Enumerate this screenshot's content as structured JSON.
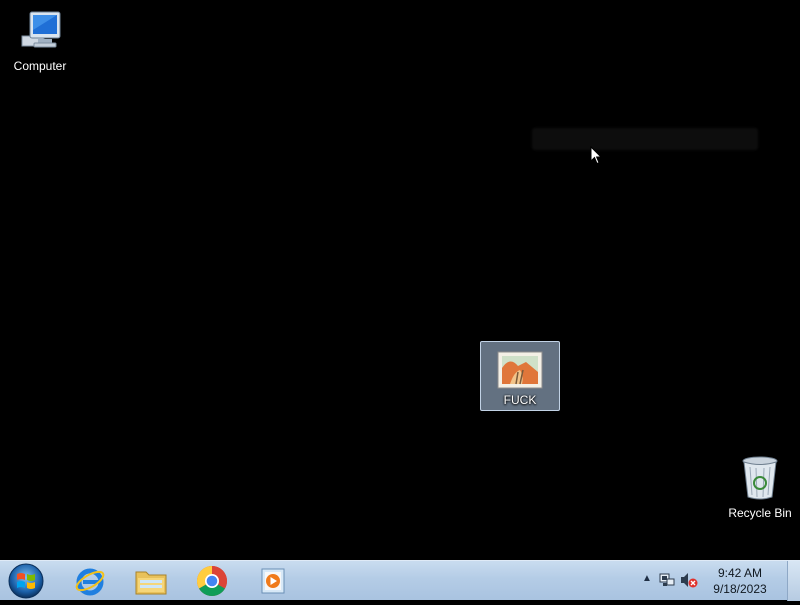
{
  "desktop": {
    "icons": [
      {
        "label": "Computer",
        "icon": "computer-icon"
      },
      {
        "label": "FUCK",
        "icon": "image-file-icon",
        "selected": true
      },
      {
        "label": "Recycle Bin",
        "icon": "recycle-bin-icon"
      }
    ]
  },
  "taskbar": {
    "start": {
      "icon": "windows-start-orb-icon"
    },
    "pinned": [
      {
        "icon": "internet-explorer-icon"
      },
      {
        "icon": "file-explorer-icon"
      },
      {
        "icon": "chrome-icon"
      },
      {
        "icon": "media-player-icon"
      }
    ],
    "tray": {
      "chevron": "▲",
      "icons": [
        "network-icon",
        "volume-muted-icon"
      ],
      "time": "9:42 AM",
      "date": "9/18/2023"
    }
  },
  "colors": {
    "desktop_bg": "#000000",
    "taskbar_bg": "#b4cce6",
    "selection": "#b4cdeb"
  }
}
